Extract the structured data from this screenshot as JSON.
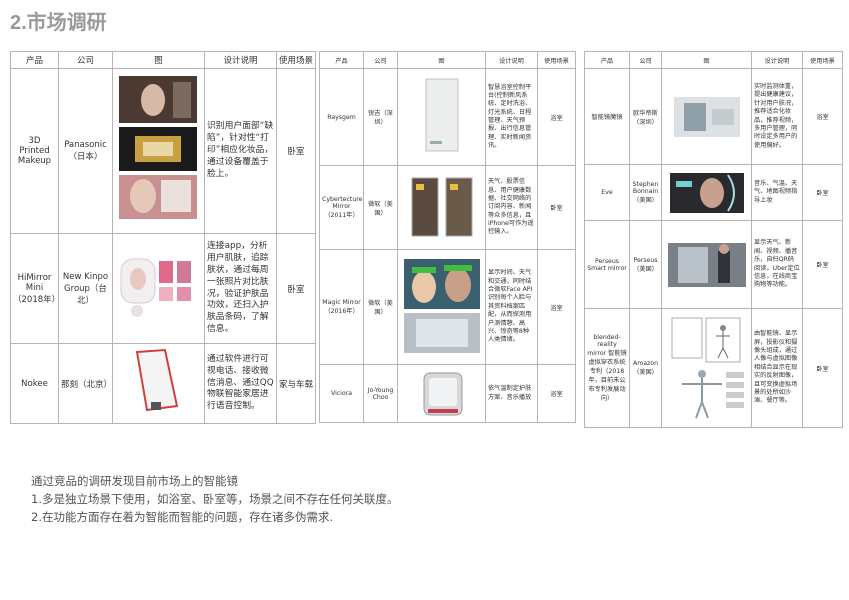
{
  "title": "2.市场调研",
  "headers": [
    "产品",
    "公司",
    "图",
    "设计说明",
    "使用场景"
  ],
  "table1": [
    {
      "product": "3D Printed Makeup",
      "company": "Panasonic（日本）",
      "design": "识别用户面部“缺陷”，针对性“打印”相应化妆品，通过设备覆盖于脸上。",
      "scene": "卧室"
    },
    {
      "product": "HiMirror Mini（2018年）",
      "company": "New Kinpo Group（台北）",
      "design": "连接app，分析用户肌肤，追踪肤状，通过每周一张照片对比肤况，验证护肤品功效，还扫入护肤品条码，了解信息。",
      "scene": "卧室"
    },
    {
      "product": "Nokee",
      "company": "那刻（北京）",
      "design": "通过软件进行可视电话、接收微信消息、通过QQ物联智能家居进行语音控制。",
      "scene": "家与车载"
    }
  ],
  "table2": [
    {
      "product": "Raysgem",
      "company": "锐吉（深圳）",
      "design": "智慧浴室控制平台(控制新风系统、定时洗浴、灯光系统、日程管理、天气预报、出行信息管理、实时新闻资讯。",
      "scene": "浴室"
    },
    {
      "product": "Cybertecture Mirror（2011年）",
      "company": "微软（美国）",
      "design": "天气、股票信息、用户健康数据、社交网络的订阅内容、新闻等众多信息，且iPhone可作为遥控输入。",
      "scene": "卧室"
    },
    {
      "product": "Magic Mirror（2016年）",
      "company": "微软（美国）",
      "design": "显示时间、天气和交通，同时结合微软Face API识别每个人脸与其资料档案匹配，从而探测用户测情憩、高兴、惊奇等8种人类情绪。",
      "scene": "浴室"
    },
    {
      "product": "Viciora",
      "company": "Jo-Young Choo",
      "design": "依气温制定护肤方案、音乐播放",
      "scene": "浴室"
    }
  ],
  "table3": [
    {
      "product": "智能镜魔镜",
      "company": "欧华帝斯（深圳）",
      "design": "实时监测体重，提出健康建议，针对用户肤况，推荐适合化妆品，推荐视频，多用户管理，同时设定多用户的使用偏好。",
      "scene": "浴室"
    },
    {
      "product": "Eve",
      "company": "Stephen Bonnain（美国）",
      "design": "音乐、气温、天气、地图视频指导上妆",
      "scene": "卧室"
    },
    {
      "product": "Perseus Smart mirror",
      "company": "Perseus（美国）",
      "design": "显示天气、新闻、视频、播音乐，自扫QR码阅读，Uber定位信息，在线商宝购物等功能。",
      "scene": "卧室"
    },
    {
      "product": "blended-reality mirror 智能镜虚拟穿衣系统专利（2018年，目前未公布专利发展动向）",
      "company": "Amazon（美国）",
      "design": "由智能镜、显示屏，投影仪和摄像头组成，通过人像与虚拟图像相结合显示在现实的反射图像，且可变换虚拟场景的处所如沙滩、餐厅等。",
      "scene": "卧室"
    }
  ],
  "summary": {
    "line1": "通过竞品的调研发现目前市场上的智能镜",
    "line2": "1.多是独立场景下使用，如浴室、卧室等，场景之间不存在任何关联度。",
    "line3": "2.在功能方面存在着为智能而智能的问题，存在诸多伪需求."
  }
}
